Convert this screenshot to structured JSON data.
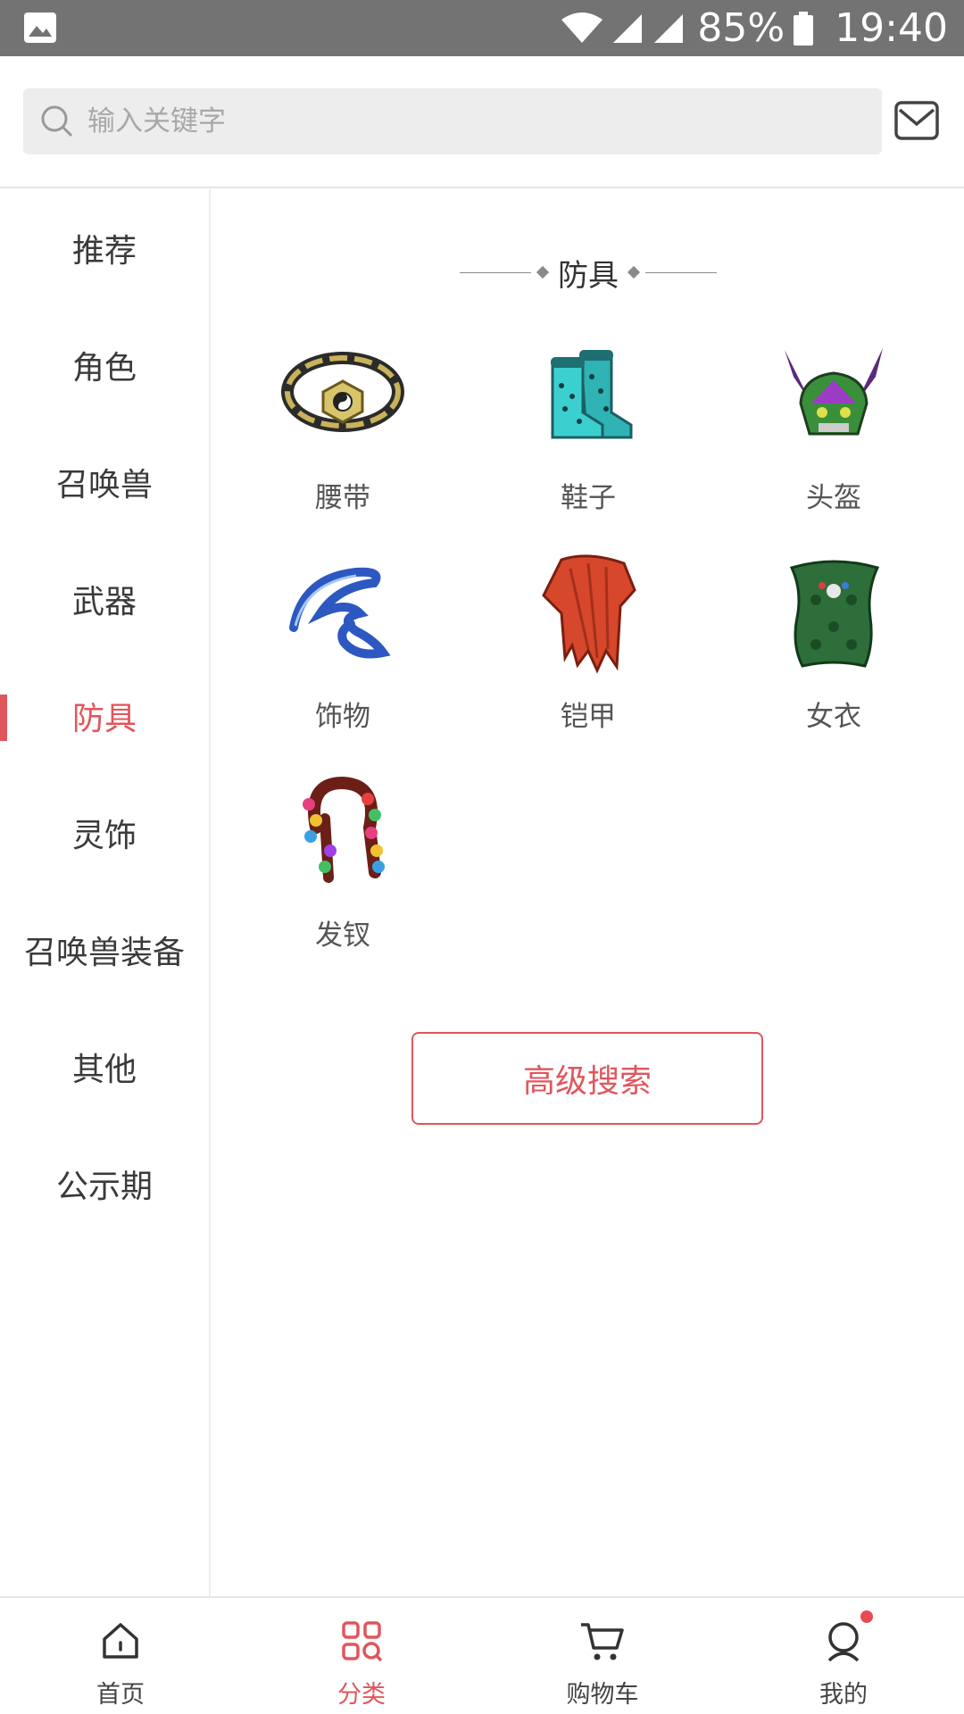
{
  "status_bar": {
    "battery": "85%",
    "time": "19:40",
    "icons": [
      "gallery-notification-icon",
      "wifi-icon",
      "signal-icon",
      "signal-icon",
      "battery-icon"
    ]
  },
  "search": {
    "placeholder": "输入关键字",
    "value": ""
  },
  "sidebar": {
    "items": [
      {
        "label": "推荐"
      },
      {
        "label": "角色"
      },
      {
        "label": "召唤兽"
      },
      {
        "label": "武器"
      },
      {
        "label": "防具",
        "active": true
      },
      {
        "label": "灵饰"
      },
      {
        "label": "召唤兽装备"
      },
      {
        "label": "其他"
      },
      {
        "label": "公示期"
      }
    ]
  },
  "content": {
    "section_title": "防具",
    "items": [
      {
        "label": "腰带",
        "icon": "belt-icon"
      },
      {
        "label": "鞋子",
        "icon": "boots-icon"
      },
      {
        "label": "头盔",
        "icon": "helmet-icon"
      },
      {
        "label": "饰物",
        "icon": "ornament-icon"
      },
      {
        "label": "铠甲",
        "icon": "armor-icon"
      },
      {
        "label": "女衣",
        "icon": "female-robe-icon"
      },
      {
        "label": "发钗",
        "icon": "hairpin-icon"
      }
    ],
    "advanced_search_label": "高级搜索"
  },
  "tabbar": {
    "tabs": [
      {
        "label": "首页",
        "icon": "home-icon"
      },
      {
        "label": "分类",
        "icon": "category-icon",
        "active": true
      },
      {
        "label": "购物车",
        "icon": "cart-icon"
      },
      {
        "label": "我的",
        "icon": "profile-icon",
        "badge": true
      }
    ]
  },
  "colors": {
    "accent": "#e0565d",
    "status_bar_bg": "#737373",
    "search_bg": "#ededed"
  }
}
